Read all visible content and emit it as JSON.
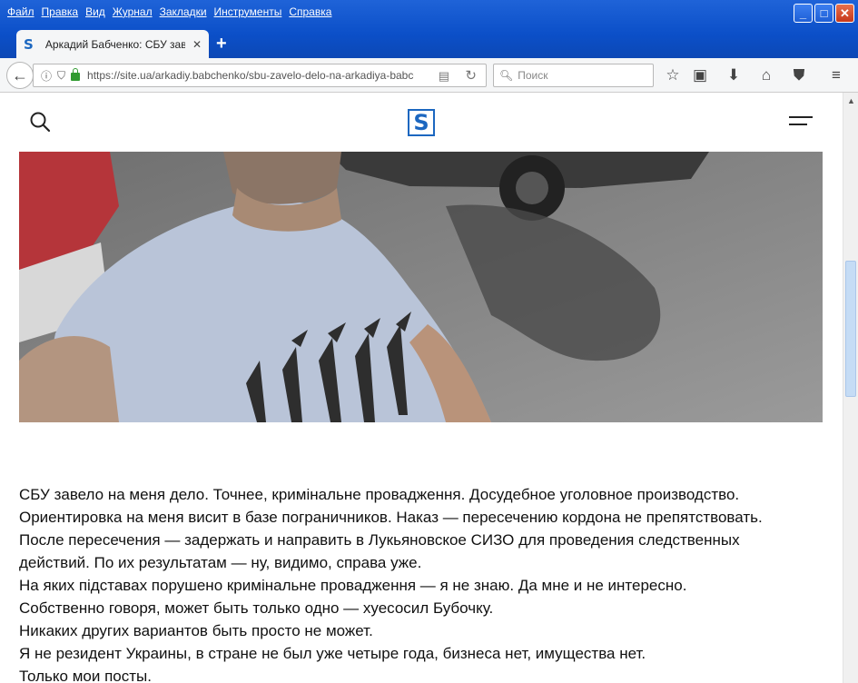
{
  "window": {
    "menu": [
      "Файл",
      "Правка",
      "Вид",
      "Журнал",
      "Закладки",
      "Инструменты",
      "Справка"
    ],
    "controls": [
      "minimize",
      "maximize",
      "close"
    ]
  },
  "tab": {
    "title": "Аркадий Бабченко: СБУ зав...",
    "favicon": "S",
    "close": "✕",
    "new_tab": "+"
  },
  "navbar": {
    "url": "https://site.ua/arkadiy.babchenko/sbu-zavelo-delo-na-arkadiya-babcenk",
    "search_placeholder": "Поиск"
  },
  "site": {
    "logo": "S"
  },
  "article": {
    "lines": [
      "СБУ завело на меня дело. Точнее, кримінальне провадження. Досудебное уголовное производство.",
      "Ориентировка на меня висит в базе пограничников. Наказ — пересечению кордона не препятствовать.",
      "После пересечения — задержать и направить в Лукьяновское СИЗО для проведения следственных",
      "действий. По их результатам — ну, видимо, справа уже.",
      "На яких підставах порушено кримінальне провадження — я не знаю. Да мне и не интересно.",
      "Собственно говоря, может быть только одно — хуесосил Бубочку.",
      "Никаких других вариантов быть просто не может.",
      "Я не резидент Украины, в стране не был уже четыре года, бизнеса нет, имущества нет.",
      "Только мои посты."
    ]
  },
  "colors": {
    "titlebar": "#0b4fc8",
    "brand": "#1c67c0",
    "lock": "#2f9a2f"
  }
}
